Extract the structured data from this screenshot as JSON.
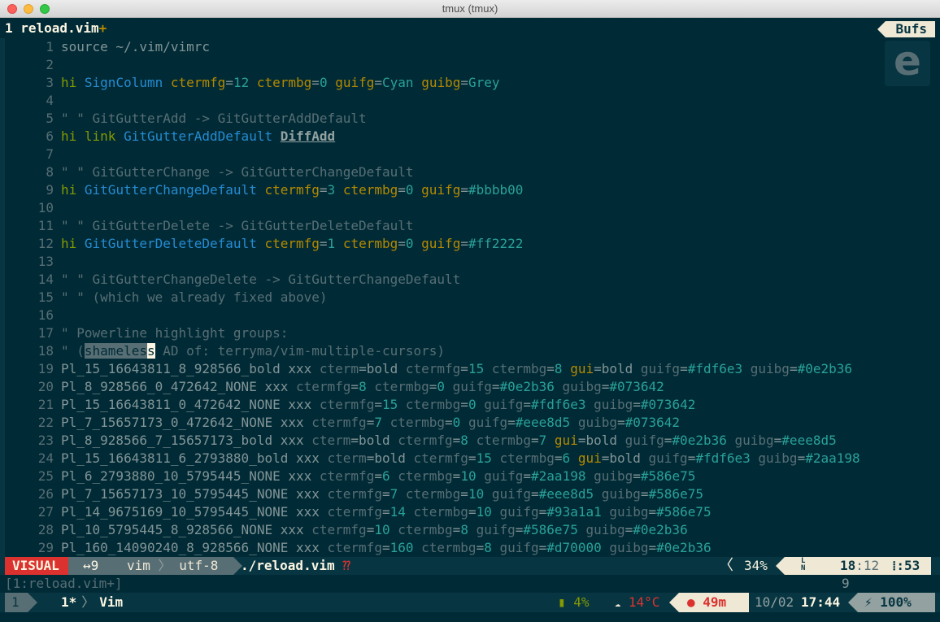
{
  "window": {
    "title": "tmux (tmux)"
  },
  "tabline": {
    "tab_label": "1 reload.vim",
    "tab_modified": "+",
    "bufs_label": "Bufs"
  },
  "logo": {
    "letter": "e"
  },
  "lines": [
    {
      "n": "1",
      "segs": [
        [
          "c-txt",
          "source ~/.vim/vimrc"
        ]
      ]
    },
    {
      "n": "2",
      "segs": []
    },
    {
      "n": "3",
      "segs": [
        [
          "c-kw",
          "hi "
        ],
        [
          "c-grp",
          "SignColumn "
        ],
        [
          "c-attr",
          "ctermfg"
        ],
        [
          "c-txt",
          "="
        ],
        [
          "c-val",
          "12 "
        ],
        [
          "c-attr",
          "ctermbg"
        ],
        [
          "c-txt",
          "="
        ],
        [
          "c-val",
          "0 "
        ],
        [
          "c-attr",
          "guifg"
        ],
        [
          "c-txt",
          "="
        ],
        [
          "c-val",
          "Cyan "
        ],
        [
          "c-attr",
          "guibg"
        ],
        [
          "c-txt",
          "="
        ],
        [
          "c-val",
          "Grey"
        ]
      ]
    },
    {
      "n": "4",
      "segs": []
    },
    {
      "n": "5",
      "segs": [
        [
          "c-cmt",
          "\" \" GitGutterAdd -> GitGutterAddDefault"
        ]
      ]
    },
    {
      "n": "6",
      "segs": [
        [
          "c-kw",
          "hi link "
        ],
        [
          "c-grp",
          "GitGutterAddDefault "
        ],
        [
          "c-bold",
          "DiffAdd"
        ]
      ]
    },
    {
      "n": "7",
      "segs": []
    },
    {
      "n": "8",
      "segs": [
        [
          "c-cmt",
          "\" \" GitGutterChange -> GitGutterChangeDefault"
        ]
      ]
    },
    {
      "n": "9",
      "segs": [
        [
          "c-kw",
          "hi "
        ],
        [
          "c-grp",
          "GitGutterChangeDefault "
        ],
        [
          "c-attr",
          "ctermfg"
        ],
        [
          "c-txt",
          "="
        ],
        [
          "c-val",
          "3 "
        ],
        [
          "c-attr",
          "ctermbg"
        ],
        [
          "c-txt",
          "="
        ],
        [
          "c-val",
          "0 "
        ],
        [
          "c-attr",
          "guifg"
        ],
        [
          "c-txt",
          "="
        ],
        [
          "c-val",
          "#bbbb00"
        ]
      ]
    },
    {
      "n": "10",
      "segs": []
    },
    {
      "n": "11",
      "segs": [
        [
          "c-cmt",
          "\" \" GitGutterDelete -> GitGutterDeleteDefault"
        ]
      ]
    },
    {
      "n": "12",
      "segs": [
        [
          "c-kw",
          "hi "
        ],
        [
          "c-grp",
          "GitGutterDeleteDefault "
        ],
        [
          "c-attr",
          "ctermfg"
        ],
        [
          "c-txt",
          "="
        ],
        [
          "c-val",
          "1 "
        ],
        [
          "c-attr",
          "ctermbg"
        ],
        [
          "c-txt",
          "="
        ],
        [
          "c-val",
          "0 "
        ],
        [
          "c-attr",
          "guifg"
        ],
        [
          "c-txt",
          "="
        ],
        [
          "c-val",
          "#ff2222"
        ]
      ]
    },
    {
      "n": "13",
      "segs": []
    },
    {
      "n": "14",
      "segs": [
        [
          "c-cmt",
          "\" \" GitGutterChangeDelete -> GitGutterChangeDefault"
        ]
      ]
    },
    {
      "n": "15",
      "segs": [
        [
          "c-cmt",
          "\" \" (which we already fixed above)"
        ]
      ]
    },
    {
      "n": "16",
      "segs": []
    },
    {
      "n": "17",
      "segs": [
        [
          "c-cmt",
          "\" Powerline highlight groups:"
        ]
      ]
    },
    {
      "n": "18",
      "segs": [
        [
          "c-cmt",
          "\" ("
        ],
        [
          "vsel",
          "shameles"
        ],
        [
          "cursor",
          "s"
        ],
        [
          "c-cmt",
          " AD of: terryma/vim-multiple-cursors)"
        ]
      ]
    },
    {
      "n": "19",
      "segs": [
        [
          "c-pl",
          "Pl_15_16643811_8_928566_bold xxx "
        ],
        [
          "c-cmt",
          "cterm"
        ],
        [
          "c-pl",
          "=bold "
        ],
        [
          "c-cmt",
          "ctermfg"
        ],
        [
          "c-pl",
          "="
        ],
        [
          "c-val",
          "15 "
        ],
        [
          "c-cmt",
          "ctermbg"
        ],
        [
          "c-pl",
          "="
        ],
        [
          "c-val",
          "8 "
        ],
        [
          "c-attr",
          "gui"
        ],
        [
          "c-pl",
          "=bold "
        ],
        [
          "c-cmt",
          "guifg"
        ],
        [
          "c-pl",
          "="
        ],
        [
          "c-val",
          "#fdf6e3 "
        ],
        [
          "c-cmt",
          "guibg"
        ],
        [
          "c-pl",
          "="
        ],
        [
          "c-val",
          "#0e2b36"
        ]
      ]
    },
    {
      "n": "20",
      "segs": [
        [
          "c-pl",
          "Pl_8_928566_0_472642_NONE xxx "
        ],
        [
          "c-cmt",
          "ctermfg"
        ],
        [
          "c-pl",
          "="
        ],
        [
          "c-val",
          "8 "
        ],
        [
          "c-cmt",
          "ctermbg"
        ],
        [
          "c-pl",
          "="
        ],
        [
          "c-val",
          "0 "
        ],
        [
          "c-cmt",
          "guifg"
        ],
        [
          "c-pl",
          "="
        ],
        [
          "c-val",
          "#0e2b36 "
        ],
        [
          "c-cmt",
          "guibg"
        ],
        [
          "c-pl",
          "="
        ],
        [
          "c-val",
          "#073642"
        ]
      ]
    },
    {
      "n": "21",
      "segs": [
        [
          "c-pl",
          "Pl_15_16643811_0_472642_NONE xxx "
        ],
        [
          "c-cmt",
          "ctermfg"
        ],
        [
          "c-pl",
          "="
        ],
        [
          "c-val",
          "15 "
        ],
        [
          "c-cmt",
          "ctermbg"
        ],
        [
          "c-pl",
          "="
        ],
        [
          "c-val",
          "0 "
        ],
        [
          "c-cmt",
          "guifg"
        ],
        [
          "c-pl",
          "="
        ],
        [
          "c-val",
          "#fdf6e3 "
        ],
        [
          "c-cmt",
          "guibg"
        ],
        [
          "c-pl",
          "="
        ],
        [
          "c-val",
          "#073642"
        ]
      ]
    },
    {
      "n": "22",
      "segs": [
        [
          "c-pl",
          "Pl_7_15657173_0_472642_NONE xxx "
        ],
        [
          "c-cmt",
          "ctermfg"
        ],
        [
          "c-pl",
          "="
        ],
        [
          "c-val",
          "7 "
        ],
        [
          "c-cmt",
          "ctermbg"
        ],
        [
          "c-pl",
          "="
        ],
        [
          "c-val",
          "0 "
        ],
        [
          "c-cmt",
          "guifg"
        ],
        [
          "c-pl",
          "="
        ],
        [
          "c-val",
          "#eee8d5 "
        ],
        [
          "c-cmt",
          "guibg"
        ],
        [
          "c-pl",
          "="
        ],
        [
          "c-val",
          "#073642"
        ]
      ]
    },
    {
      "n": "23",
      "segs": [
        [
          "c-pl",
          "Pl_8_928566_7_15657173_bold xxx "
        ],
        [
          "c-cmt",
          "cterm"
        ],
        [
          "c-pl",
          "=bold "
        ],
        [
          "c-cmt",
          "ctermfg"
        ],
        [
          "c-pl",
          "="
        ],
        [
          "c-val",
          "8 "
        ],
        [
          "c-cmt",
          "ctermbg"
        ],
        [
          "c-pl",
          "="
        ],
        [
          "c-val",
          "7 "
        ],
        [
          "c-attr",
          "gui"
        ],
        [
          "c-pl",
          "=bold "
        ],
        [
          "c-cmt",
          "guifg"
        ],
        [
          "c-pl",
          "="
        ],
        [
          "c-val",
          "#0e2b36 "
        ],
        [
          "c-cmt",
          "guibg"
        ],
        [
          "c-pl",
          "="
        ],
        [
          "c-val",
          "#eee8d5"
        ]
      ]
    },
    {
      "n": "24",
      "segs": [
        [
          "c-pl",
          "Pl_15_16643811_6_2793880_bold xxx "
        ],
        [
          "c-cmt",
          "cterm"
        ],
        [
          "c-pl",
          "=bold "
        ],
        [
          "c-cmt",
          "ctermfg"
        ],
        [
          "c-pl",
          "="
        ],
        [
          "c-val",
          "15 "
        ],
        [
          "c-cmt",
          "ctermbg"
        ],
        [
          "c-pl",
          "="
        ],
        [
          "c-val",
          "6 "
        ],
        [
          "c-attr",
          "gui"
        ],
        [
          "c-pl",
          "=bold "
        ],
        [
          "c-cmt",
          "guifg"
        ],
        [
          "c-pl",
          "="
        ],
        [
          "c-val",
          "#fdf6e3 "
        ],
        [
          "c-cmt",
          "guibg"
        ],
        [
          "c-pl",
          "="
        ],
        [
          "c-val",
          "#2aa198"
        ]
      ]
    },
    {
      "n": "25",
      "segs": [
        [
          "c-pl",
          "Pl_6_2793880_10_5795445_NONE xxx "
        ],
        [
          "c-cmt",
          "ctermfg"
        ],
        [
          "c-pl",
          "="
        ],
        [
          "c-val",
          "6 "
        ],
        [
          "c-cmt",
          "ctermbg"
        ],
        [
          "c-pl",
          "="
        ],
        [
          "c-val",
          "10 "
        ],
        [
          "c-cmt",
          "guifg"
        ],
        [
          "c-pl",
          "="
        ],
        [
          "c-val",
          "#2aa198 "
        ],
        [
          "c-cmt",
          "guibg"
        ],
        [
          "c-pl",
          "="
        ],
        [
          "c-val",
          "#586e75"
        ]
      ]
    },
    {
      "n": "26",
      "segs": [
        [
          "c-pl",
          "Pl_7_15657173_10_5795445_NONE xxx "
        ],
        [
          "c-cmt",
          "ctermfg"
        ],
        [
          "c-pl",
          "="
        ],
        [
          "c-val",
          "7 "
        ],
        [
          "c-cmt",
          "ctermbg"
        ],
        [
          "c-pl",
          "="
        ],
        [
          "c-val",
          "10 "
        ],
        [
          "c-cmt",
          "guifg"
        ],
        [
          "c-pl",
          "="
        ],
        [
          "c-val",
          "#eee8d5 "
        ],
        [
          "c-cmt",
          "guibg"
        ],
        [
          "c-pl",
          "="
        ],
        [
          "c-val",
          "#586e75"
        ]
      ]
    },
    {
      "n": "27",
      "segs": [
        [
          "c-pl",
          "Pl_14_9675169_10_5795445_NONE xxx "
        ],
        [
          "c-cmt",
          "ctermfg"
        ],
        [
          "c-pl",
          "="
        ],
        [
          "c-val",
          "14 "
        ],
        [
          "c-cmt",
          "ctermbg"
        ],
        [
          "c-pl",
          "="
        ],
        [
          "c-val",
          "10 "
        ],
        [
          "c-cmt",
          "guifg"
        ],
        [
          "c-pl",
          "="
        ],
        [
          "c-val",
          "#93a1a1 "
        ],
        [
          "c-cmt",
          "guibg"
        ],
        [
          "c-pl",
          "="
        ],
        [
          "c-val",
          "#586e75"
        ]
      ]
    },
    {
      "n": "28",
      "segs": [
        [
          "c-pl",
          "Pl_10_5795445_8_928566_NONE xxx "
        ],
        [
          "c-cmt",
          "ctermfg"
        ],
        [
          "c-pl",
          "="
        ],
        [
          "c-val",
          "10 "
        ],
        [
          "c-cmt",
          "ctermbg"
        ],
        [
          "c-pl",
          "="
        ],
        [
          "c-val",
          "8 "
        ],
        [
          "c-cmt",
          "guifg"
        ],
        [
          "c-pl",
          "="
        ],
        [
          "c-val",
          "#586e75 "
        ],
        [
          "c-cmt",
          "guibg"
        ],
        [
          "c-pl",
          "="
        ],
        [
          "c-val",
          "#0e2b36"
        ]
      ]
    },
    {
      "n": "29",
      "segs": [
        [
          "c-pl",
          "Pl_160_14090240_8_928566_NONE xxx "
        ],
        [
          "c-cmt",
          "ctermfg"
        ],
        [
          "c-pl",
          "="
        ],
        [
          "c-val",
          "160 "
        ],
        [
          "c-cmt",
          "ctermbg"
        ],
        [
          "c-pl",
          "="
        ],
        [
          "c-val",
          "8 "
        ],
        [
          "c-cmt",
          "guifg"
        ],
        [
          "c-pl",
          "="
        ],
        [
          "c-val",
          "#d70000 "
        ],
        [
          "c-cmt",
          "guibg"
        ],
        [
          "c-pl",
          "="
        ],
        [
          "c-val",
          "#0e2b36"
        ]
      ]
    }
  ],
  "statusline": {
    "mode": "VISUAL",
    "selection": "↔9",
    "filetype": "vim",
    "sep": "〉",
    "encoding": "utf-8",
    "filename": "./reload.vim",
    "modified_flag": "⁇",
    "left_chevron": "〈",
    "percent": "34%",
    "ln_icon": "L N",
    "line": "18",
    "col": ":12",
    "colnum": "⁞:53"
  },
  "cmdline": {
    "left": "[1:reload.vim+]",
    "right": "9"
  },
  "tmux": {
    "session": "1",
    "window": "1*",
    "window_chev": "〉",
    "window_name": "Vim",
    "battery": "▮ 4%",
    "weather_icon": "☁",
    "weather": "14°C",
    "tomato": "● 49m",
    "date": "10/02",
    "time": "17:44",
    "power": "⚡ 100%"
  },
  "colors": {
    "background": "#002b36",
    "mode_red": "#dc322f",
    "keyword": "#859900",
    "group": "#268bd2",
    "attr": "#b58900",
    "value": "#2aa198"
  }
}
